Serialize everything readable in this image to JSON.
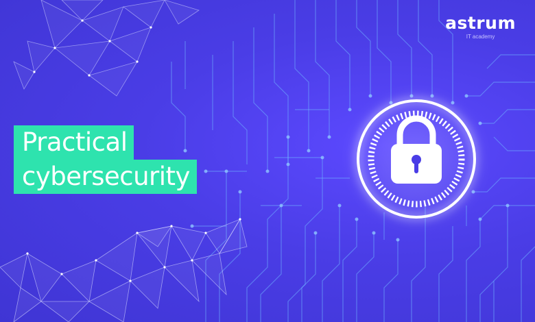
{
  "brand": {
    "name": "astrum",
    "tagline": "IT academy"
  },
  "headline": {
    "line1": "Practical",
    "line2": "cybersecurity"
  },
  "colors": {
    "background": "#4a3de6",
    "accent": "#2ee3ae",
    "circuit": "#6fb0ff",
    "glow": "#ffffff"
  },
  "icons": [
    "padlock-icon",
    "circuit-pattern",
    "polygon-network"
  ]
}
